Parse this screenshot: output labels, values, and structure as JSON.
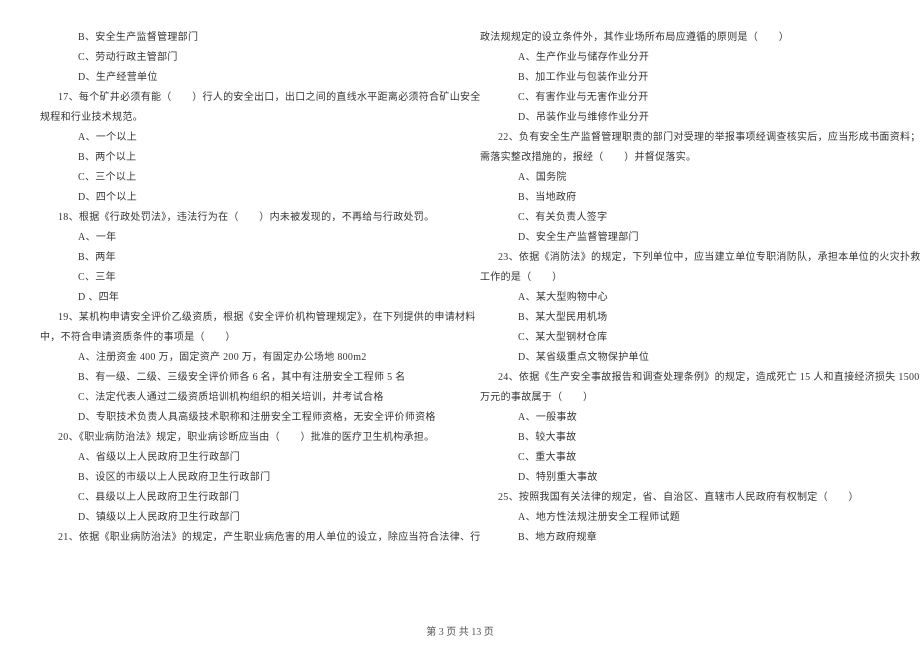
{
  "footer": "第 3 页 共 13 页",
  "left": {
    "opt_b_1": "B、安全生产监督管理部门",
    "opt_c_1": "C、劳动行政主管部门",
    "opt_d_1": "D、生产经营单位",
    "q17_a": "17、每个矿井必须有能（　　）行人的安全出口，出口之间的直线水平距离必须符合矿山安全",
    "q17_b": "规程和行业技术规范。",
    "q17_opt_a": "A、一个以上",
    "q17_opt_b": "B、两个以上",
    "q17_opt_c": "C、三个以上",
    "q17_opt_d": "D、四个以上",
    "q18": "18、根据《行政处罚法》，违法行为在（　　）内未被发现的，不再给与行政处罚。",
    "q18_opt_a": "A、一年",
    "q18_opt_b": "B、两年",
    "q18_opt_c": "C、三年",
    "q18_opt_d": "D 、四年",
    "q19_a": "19、某机构申请安全评价乙级资质，根据《安全评价机构管理规定》，在下列提供的申请材料",
    "q19_b": "中，不符合申请资质条件的事项是（　　）",
    "q19_opt_a": "A、注册资金 400 万，固定资产 200 万，有固定办公场地 800m2",
    "q19_opt_b": "B、有一级、二级、三级安全评价师各 6 名，其中有注册安全工程师 5 名",
    "q19_opt_c": "C、法定代表人通过二级资质培训机构组织的相关培训，并考试合格",
    "q19_opt_d": "D、专职技术负责人具高级技术职称和注册安全工程师资格，无安全评价师资格",
    "q20": "20、《职业病防治法》规定，职业病诊断应当由（　　）批准的医疗卫生机构承担。",
    "q20_opt_a": "A、省级以上人民政府卫生行政部门",
    "q20_opt_b": "B、设区的市级以上人民政府卫生行政部门",
    "q20_opt_c": "C、县级以上人民政府卫生行政部门",
    "q20_opt_d": "D、镇级以上人民政府卫生行政部门",
    "q21_a": "21、依据《职业病防治法》的规定，产生职业病危害的用人单位的设立，除应当符合法律、行"
  },
  "right": {
    "q21_b": "政法规规定的设立条件外，其作业场所布局应遵循的原则是（　　）",
    "q21_opt_a": "A、生产作业与储存作业分开",
    "q21_opt_b": "B、加工作业与包装作业分开",
    "q21_opt_c": "C、有害作业与无害作业分开",
    "q21_opt_d": "D、吊装作业与维修作业分开",
    "q22_a": "22、负有安全生产监督管理职责的部门对受理的举报事项经调查核实后，应当形成书面资料；",
    "q22_b": "需落实整改措施的，报经（　　）并督促落实。",
    "q22_opt_a": "A、国务院",
    "q22_opt_b": "B、当地政府",
    "q22_opt_c": "C、有关负责人签字",
    "q22_opt_d": "D、安全生产监督管理部门",
    "q23_a": "23、依据《消防法》的规定，下列单位中，应当建立单位专职消防队，承担本单位的火灾扑救",
    "q23_b": "工作的是（　　）",
    "q23_opt_a": "A、某大型购物中心",
    "q23_opt_b": "B、某大型民用机场",
    "q23_opt_c": "C、某大型钢材仓库",
    "q23_opt_d": "D、某省级重点文物保护单位",
    "q24_a": "24、依据《生产安全事故报告和调查处理条例》的规定，造成死亡 15 人和直接经济损失 1500",
    "q24_b": "万元的事故属于（　　）",
    "q24_opt_a": "A、一般事故",
    "q24_opt_b": "B、较大事故",
    "q24_opt_c": "C、重大事故",
    "q24_opt_d": "D、特别重大事故",
    "q25": "25、按照我国有关法律的规定，省、自治区、直辖市人民政府有权制定（　　）",
    "q25_opt_a": "A、地方性法规注册安全工程师试题",
    "q25_opt_b": "B、地方政府规章"
  }
}
